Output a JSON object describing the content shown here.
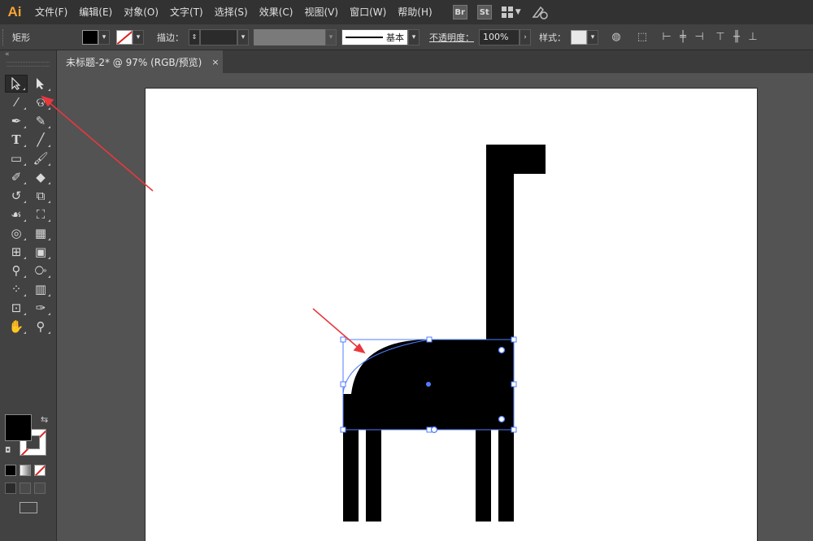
{
  "app": {
    "logo": "Ai"
  },
  "menu": [
    "文件(F)",
    "编辑(E)",
    "对象(O)",
    "文字(T)",
    "选择(S)",
    "效果(C)",
    "视图(V)",
    "窗口(W)",
    "帮助(H)"
  ],
  "menu_badges": {
    "bridge": "Br",
    "stock": "St"
  },
  "control": {
    "object_type": "矩形",
    "stroke_label": "描边：",
    "stroke_style": "基本",
    "opacity_label": "不透明度：",
    "opacity_value": "100%",
    "style_label": "样式："
  },
  "document": {
    "tab_title": "未标题-2* @ 97% (RGB/预览)",
    "close_glyph": "×"
  },
  "colors": {
    "fill": "#000000",
    "accent": "#f8a434",
    "selection": "#4f7cff",
    "arrow": "#e8383d"
  },
  "icons": {
    "tools_left": [
      "selection-icon",
      "magic-wand-icon",
      "pen-icon",
      "type-icon",
      "rectangle-icon",
      "shaper-icon",
      "rotate-icon",
      "warp-icon",
      "shape-builder-icon",
      "mesh-icon",
      "eyedropper-icon",
      "symbol-sprayer-icon",
      "artboard-icon",
      "hand-icon"
    ],
    "tools_right": [
      "direct-selection-icon",
      "lasso-icon",
      "curvature-icon",
      "line-icon",
      "paintbrush-icon",
      "eraser-icon",
      "scale-icon",
      "free-transform-icon",
      "perspective-grid-icon",
      "gradient-icon",
      "blend-icon",
      "column-graph-icon",
      "slice-icon",
      "zoom-icon"
    ]
  }
}
